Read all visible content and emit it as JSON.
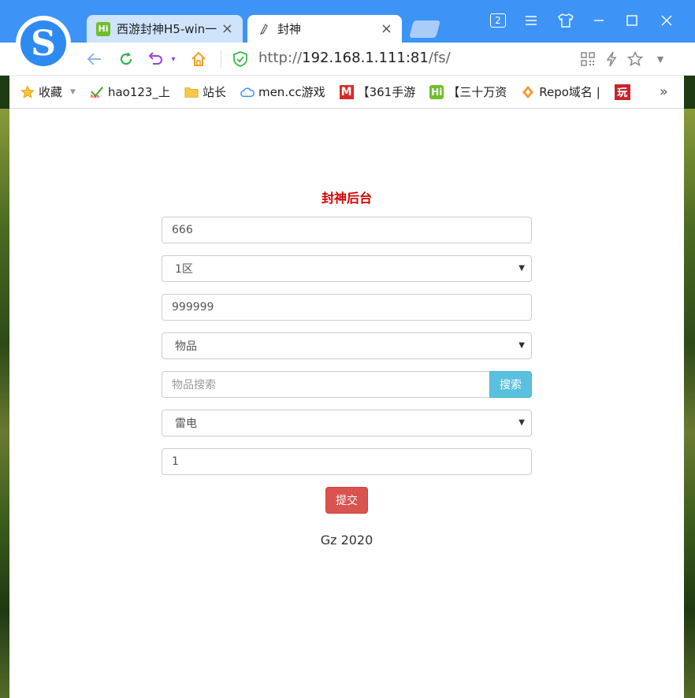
{
  "browser": {
    "tabs": [
      {
        "label": "西游封神H5-win一",
        "icon": "hi-icon"
      },
      {
        "label": "封神",
        "icon": "feather-icon"
      }
    ],
    "tab_count": "2",
    "url": {
      "scheme": "http://",
      "host": "192.168.1.111:81",
      "path": "/fs/"
    }
  },
  "bookmarks": [
    {
      "label": "收藏",
      "icon": "star-icon"
    },
    {
      "label": "hao123_上",
      "icon": "hao-icon"
    },
    {
      "label": "站长",
      "icon": "folder-icon"
    },
    {
      "label": "men.cc游戏",
      "icon": "cloud-icon"
    },
    {
      "label": "【361手游",
      "icon": "m-icon"
    },
    {
      "label": "【三十万资",
      "icon": "hi-icon"
    },
    {
      "label": "Repo域名 |",
      "icon": "repo-icon"
    },
    {
      "label": "玩",
      "icon": "wan-icon"
    }
  ],
  "form": {
    "title": "封神后台",
    "account_value": "666",
    "server_selected": "1区",
    "amount_value": "999999",
    "type_selected": "物品",
    "search_placeholder": "物品搜索",
    "search_label": "搜索",
    "item_selected": "雷电",
    "quantity_value": "1",
    "submit_label": "提交"
  },
  "footer": {
    "text": "Gz 2020"
  },
  "colors": {
    "title": "#d20000",
    "search_btn": "#5bc0de",
    "submit_btn": "#d9534f",
    "chrome": "#3d94f6"
  }
}
